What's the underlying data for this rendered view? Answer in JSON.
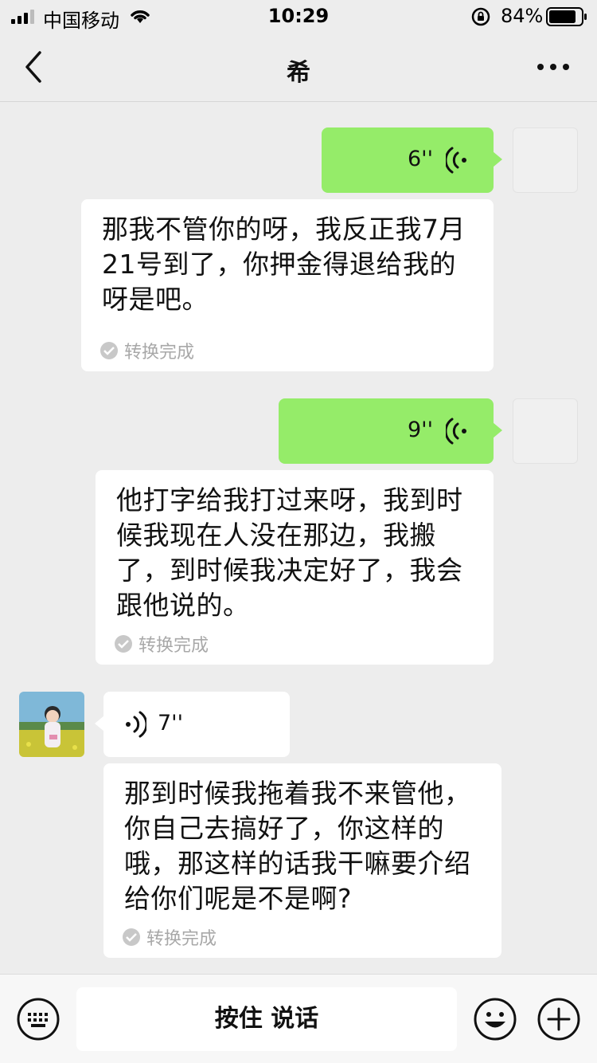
{
  "status_bar": {
    "carrier": "中国移动",
    "time": "10:29",
    "battery_percent": "84%"
  },
  "nav": {
    "title": "希"
  },
  "messages": [
    {
      "sender": "me",
      "duration": "6''",
      "transcript": "那我不管你的呀，我反正我7月21号到了，你押金得退给我的呀是吧。",
      "convert_status": "转换完成"
    },
    {
      "sender": "me",
      "duration": "9''",
      "transcript": "他打字给我打过来呀，我到时候我现在人没在那边，我搬了，到时候我决定好了，我会跟他说的。",
      "convert_status": "转换完成"
    },
    {
      "sender": "friend",
      "duration": "7''",
      "transcript": "那到时候我拖着我不来管他，你自己去搞好了，你这样的哦，那这样的话我干嘛要介绍给你们呢是不是啊?",
      "convert_status": "转换完成"
    }
  ],
  "input_bar": {
    "talk_label": "按住 说话"
  },
  "icons": {
    "back": "chevron-left-icon",
    "more": "more-dots-icon",
    "voice": "voice-wave-icon",
    "keyboard": "keyboard-icon",
    "emoji": "emoji-icon",
    "plus": "plus-icon"
  },
  "colors": {
    "background": "#ededed",
    "bubble_self": "#95ec69",
    "bubble_other": "#ffffff",
    "status_text": "#a8a8a8"
  }
}
